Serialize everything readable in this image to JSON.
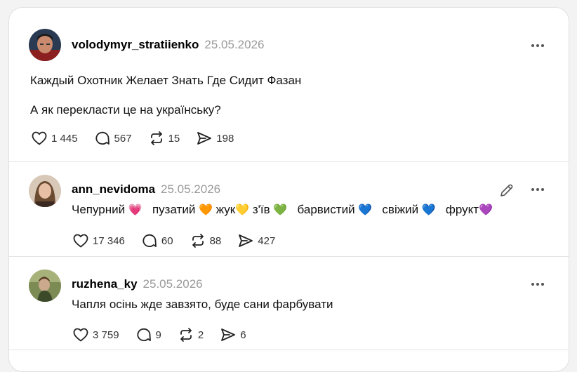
{
  "posts": [
    {
      "username": "volodymyr_stratiienko",
      "date": "25.05.2026",
      "lines": [
        "Каждый Охотник Желает Знать Где Сидит Фазан",
        "А як перекласти це на українську?"
      ],
      "likes": "1 445",
      "replies": "567",
      "reposts": "15",
      "shares": "198"
    },
    {
      "username": "ann_nevidoma",
      "date": "25.05.2026",
      "text_parts": [
        {
          "word": "Чепурний",
          "emoji": "💗",
          "color": "#e8388a"
        },
        {
          "word": "пузатий",
          "emoji": "🧡",
          "color": "#f4783a"
        },
        {
          "word": "жук",
          "emoji": "💛",
          "color": "#f5c23b"
        },
        {
          "word": "з'їв",
          "emoji": "💚",
          "color": "#29a56a"
        },
        {
          "word": "барвистий",
          "emoji": "💙",
          "color": "#55aee8"
        },
        {
          "word": "свіжий",
          "emoji": "💙",
          "color": "#3a6ee0"
        },
        {
          "word": "фрукт",
          "emoji": "💜",
          "color": "#9b3ed6"
        }
      ],
      "likes": "17 346",
      "replies": "60",
      "reposts": "88",
      "shares": "427"
    },
    {
      "username": "ruzhena_ky",
      "date": "25.05.2026",
      "line": "Чапля осінь жде завзято, буде сани фарбувати",
      "likes": "3 759",
      "replies": "9",
      "reposts": "2",
      "shares": "6"
    }
  ]
}
